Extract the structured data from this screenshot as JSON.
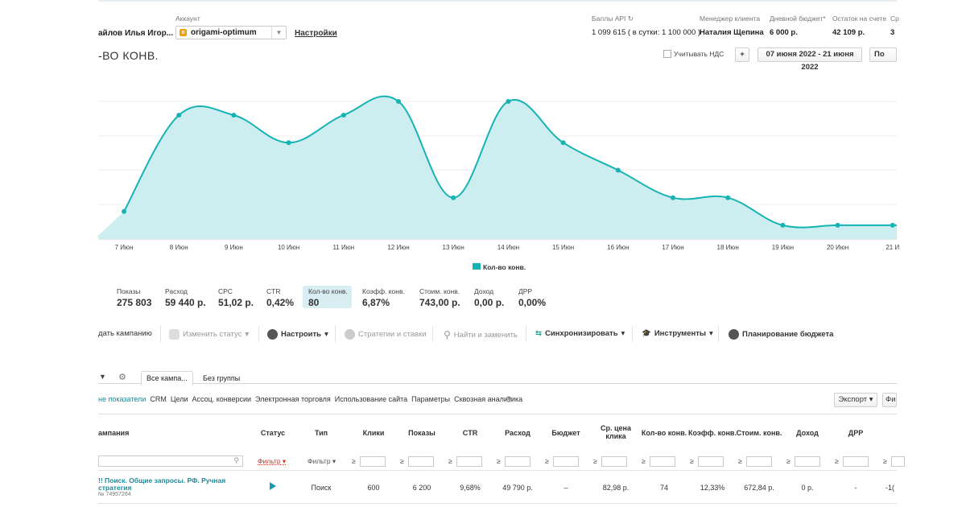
{
  "header": {
    "user_name": "айлов Илья Игор...",
    "account_label": "Аккаунт",
    "account_value": "origami-optimum",
    "settings_link": "Настройки",
    "api_label": "Баллы API",
    "api_value": "1 099 615 ( в сутки: 1 100 000 )",
    "manager_label": "Менеджер клиента",
    "manager_value": "Наталия Щепина",
    "daily_budget_label": "Дневной бюджет*",
    "daily_budget_value": "6 000 р.",
    "balance_label": "Остаток на счете",
    "balance_value": "42 109 р.",
    "extra_label": "Ср",
    "extra_value": "3"
  },
  "chart_controls": {
    "title": "-во конв.",
    "vat_label": "Учитывать НДС",
    "plus_label": "+",
    "date_range": "07 июня 2022 - 21 июня 2022",
    "group_label": "По дня"
  },
  "chart_data": {
    "type": "area",
    "categories": [
      "7 Июн",
      "8 Июн",
      "9 Июн",
      "10 Июн",
      "11 Июн",
      "12 Июн",
      "13 Июн",
      "14 Июн",
      "15 Июн",
      "16 Июн",
      "17 Июн",
      "18 Июн",
      "19 Июн",
      "20 Июн",
      "21 И"
    ],
    "series": [
      {
        "name": "Кол-во конв.",
        "values": [
          2,
          9,
          9,
          7,
          9,
          10,
          3,
          10,
          7,
          5,
          3,
          3,
          1,
          1,
          1
        ],
        "color": "#17b3b3",
        "fill": "#cdeef0"
      }
    ],
    "ylim": [
      0,
      10
    ],
    "grid": true,
    "legend_position": "bottom-center"
  },
  "metrics": [
    {
      "label": "Показы",
      "value": "275 803"
    },
    {
      "label": "Расход",
      "value": "59 440 р."
    },
    {
      "label": "CPC",
      "value": "51,02 р."
    },
    {
      "label": "CTR",
      "value": "0,42%"
    },
    {
      "label": "Кол-во конв.",
      "value": "80"
    },
    {
      "label": "Коэфф. конв.",
      "value": "6,87%"
    },
    {
      "label": "Стоим. конв.",
      "value": "743,00 р."
    },
    {
      "label": "Доход",
      "value": "0,00 р."
    },
    {
      "label": "ДРР",
      "value": "0,00%"
    }
  ],
  "toolbar": {
    "create": "дать кампанию",
    "change_status": "Изменить статус",
    "configure": "Настроить",
    "strategies": "Стратегии и ставки",
    "find_replace": "Найти и заменить",
    "sync": "Синхронизировать",
    "tools": "Инструменты",
    "budget_planning": "Планирование бюджета"
  },
  "tabs": {
    "all": "Все кампа...",
    "no_group": "Без группы"
  },
  "subnav": [
    "не показатели",
    "CRM",
    "Цели",
    "Ассоц. конверсии",
    "Электронная торговля",
    "Использование сайта",
    "Параметры",
    "Сквозная аналитика"
  ],
  "export_label": "Экспорт",
  "filter_btn_label": "Фи",
  "table": {
    "headers": {
      "campaign": "ампания",
      "status": "Статус",
      "type": "Тип",
      "clicks": "Клики",
      "impressions": "Показы",
      "ctr": "CTR",
      "spend": "Расход",
      "budget": "Бюджет",
      "avg_cpc": "Ср. цена клика",
      "conv": "Кол-во конв.",
      "conv_rate": "Коэфф. конв.",
      "conv_cost": "Стоим. конв.",
      "income": "Доход",
      "drr": "ДРР"
    },
    "filter_status": "Фильтр",
    "filter_type": "Фильтр",
    "ge_symbol": "≥",
    "row": {
      "name": "!! Поиск. Общие запросы. РФ. Ручная стратегия",
      "id": "№ 74957264",
      "type": "Поиск",
      "clicks": "600",
      "impressions": "6 200",
      "ctr": "9,68%",
      "spend": "49 790 р.",
      "budget": "–",
      "avg_cpc": "82,98 р.",
      "conv": "74",
      "conv_rate": "12,33%",
      "conv_cost": "672,84 р.",
      "income": "0 р.",
      "drr": "-",
      "extra": "-1("
    }
  }
}
